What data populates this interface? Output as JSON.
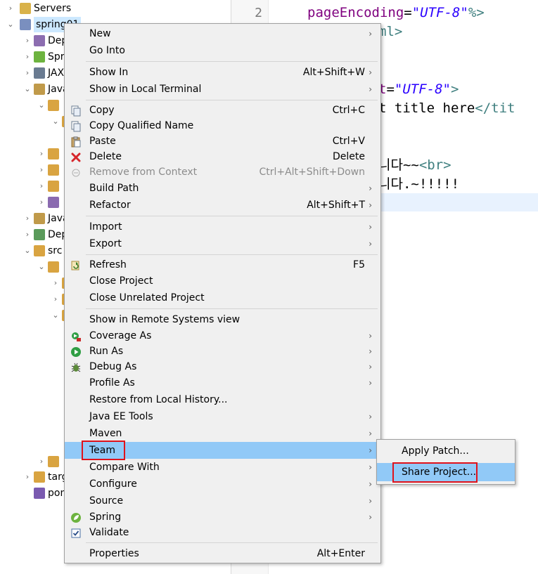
{
  "explorer": {
    "rows": [
      {
        "label": "Servers",
        "twisty": "›"
      },
      {
        "label": "spring01",
        "twisty": "⌄"
      },
      {
        "label": "Dep",
        "twisty": "›"
      },
      {
        "label": "Spr",
        "twisty": "›"
      },
      {
        "label": "JAX",
        "twisty": "›"
      },
      {
        "label": "Java",
        "twisty": "⌄"
      },
      {
        "label": "",
        "twisty": "⌄"
      },
      {
        "label": "",
        "twisty": "⌄"
      },
      {
        "label": "",
        "twisty": "›"
      },
      {
        "label": "",
        "twisty": "›"
      },
      {
        "label": "",
        "twisty": "›"
      },
      {
        "label": "",
        "twisty": "›"
      },
      {
        "label": "Java",
        "twisty": "›"
      },
      {
        "label": "Dep",
        "twisty": "›"
      },
      {
        "label": "src",
        "twisty": "⌄"
      },
      {
        "label": "",
        "twisty": "⌄"
      },
      {
        "label": "",
        "twisty": "›"
      },
      {
        "label": "",
        "twisty": "›"
      },
      {
        "label": "",
        "twisty": "⌄"
      },
      {
        "label": "",
        "twisty": "›"
      },
      {
        "label": "targ",
        "twisty": "›"
      },
      {
        "label": "pom",
        "twisty": ""
      }
    ]
  },
  "editor": {
    "line_number": "2",
    "line1_attr": "pageEncoding",
    "line1_eq": "=",
    "line1_val": "\"UTF-8\"",
    "line1_end": "%>",
    "line2": "ml>",
    "line3_attr": "t",
    "line3_eq": "=",
    "line3_val": "\"UTF-8\"",
    "line3_end": ">",
    "line4_text": "t title here",
    "line4_tag": "</tit",
    "line5_text": "니다~~",
    "line5_tag": "<br>",
    "line6_text": "니다.~!!!!!"
  },
  "context_menu": {
    "items": {
      "new": {
        "label": "New"
      },
      "go_into": {
        "label": "Go Into"
      },
      "show_in": {
        "label": "Show In",
        "accel": "Alt+Shift+W"
      },
      "show_local_terminal": {
        "label": "Show in Local Terminal"
      },
      "copy": {
        "label": "Copy",
        "accel": "Ctrl+C"
      },
      "copy_qualified": {
        "label": "Copy Qualified Name"
      },
      "paste": {
        "label": "Paste",
        "accel": "Ctrl+V"
      },
      "delete": {
        "label": "Delete",
        "accel": "Delete"
      },
      "remove_context": {
        "label": "Remove from Context",
        "accel": "Ctrl+Alt+Shift+Down"
      },
      "build_path": {
        "label": "Build Path"
      },
      "refactor": {
        "label": "Refactor",
        "accel": "Alt+Shift+T"
      },
      "import": {
        "label": "Import"
      },
      "export": {
        "label": "Export"
      },
      "refresh": {
        "label": "Refresh",
        "accel": "F5"
      },
      "close_project": {
        "label": "Close Project"
      },
      "close_unrelated": {
        "label": "Close Unrelated Project"
      },
      "show_remote": {
        "label": "Show in Remote Systems view"
      },
      "coverage_as": {
        "label": "Coverage As"
      },
      "run_as": {
        "label": "Run As"
      },
      "debug_as": {
        "label": "Debug As"
      },
      "profile_as": {
        "label": "Profile As"
      },
      "restore_history": {
        "label": "Restore from Local History..."
      },
      "javaee_tools": {
        "label": "Java EE Tools"
      },
      "maven": {
        "label": "Maven"
      },
      "team": {
        "label": "Team"
      },
      "compare_with": {
        "label": "Compare With"
      },
      "configure": {
        "label": "Configure"
      },
      "source": {
        "label": "Source"
      },
      "spring": {
        "label": "Spring"
      },
      "validate": {
        "label": "Validate"
      },
      "properties": {
        "label": "Properties",
        "accel": "Alt+Enter"
      }
    },
    "arrow": "›"
  },
  "team_submenu": {
    "apply_patch": "Apply Patch...",
    "share_project": "Share Project..."
  },
  "colors": {
    "highlight": "#91c9f7",
    "annotation_box": "#e0121b"
  }
}
